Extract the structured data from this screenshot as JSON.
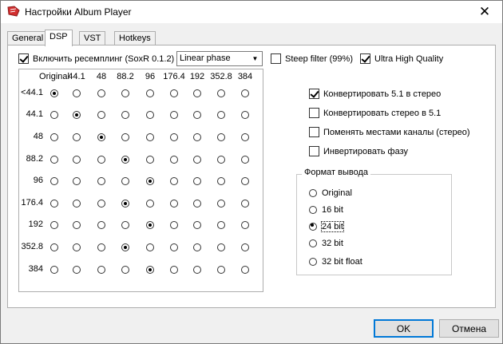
{
  "window": {
    "title": "Настройки Album Player",
    "close_symbol": "✕"
  },
  "tabs": [
    "General",
    "DSP",
    "VST",
    "Hotkeys"
  ],
  "resampling": {
    "label": "Включить ресемплинг (SoxR 0.1.2)",
    "checked": true
  },
  "filter_select": {
    "value": "Linear phase"
  },
  "steep_filter": {
    "label": "Steep filter (99%)",
    "checked": false
  },
  "ultra_hq": {
    "label": "Ultra High Quality",
    "checked": true
  },
  "matrix": {
    "columns": [
      "Original",
      "44.1",
      "48",
      "88.2",
      "96",
      "176.4",
      "192",
      "352.8",
      "384"
    ],
    "rows": [
      "<44.1",
      "44.1",
      "48",
      "88.2",
      "96",
      "176.4",
      "192",
      "352.8",
      "384"
    ],
    "selected": [
      0,
      1,
      2,
      3,
      4,
      3,
      4,
      3,
      4
    ]
  },
  "options": [
    {
      "label": "Конвертировать 5.1 в стерео",
      "checked": true
    },
    {
      "label": "Конвертировать стерео в 5.1",
      "checked": false
    },
    {
      "label": "Поменять местами каналы (стерео)",
      "checked": false
    },
    {
      "label": "Инвертировать фазу",
      "checked": false
    }
  ],
  "output_format": {
    "legend": "Формат вывода",
    "items": [
      "Original",
      "16 bit",
      "24 bit",
      "32 bit",
      "32 bit float"
    ],
    "selected": 2
  },
  "buttons": {
    "ok": "OK",
    "cancel": "Отмена"
  },
  "colors": {
    "accent": "#0078d7",
    "icon_red": "#d32f2f"
  }
}
